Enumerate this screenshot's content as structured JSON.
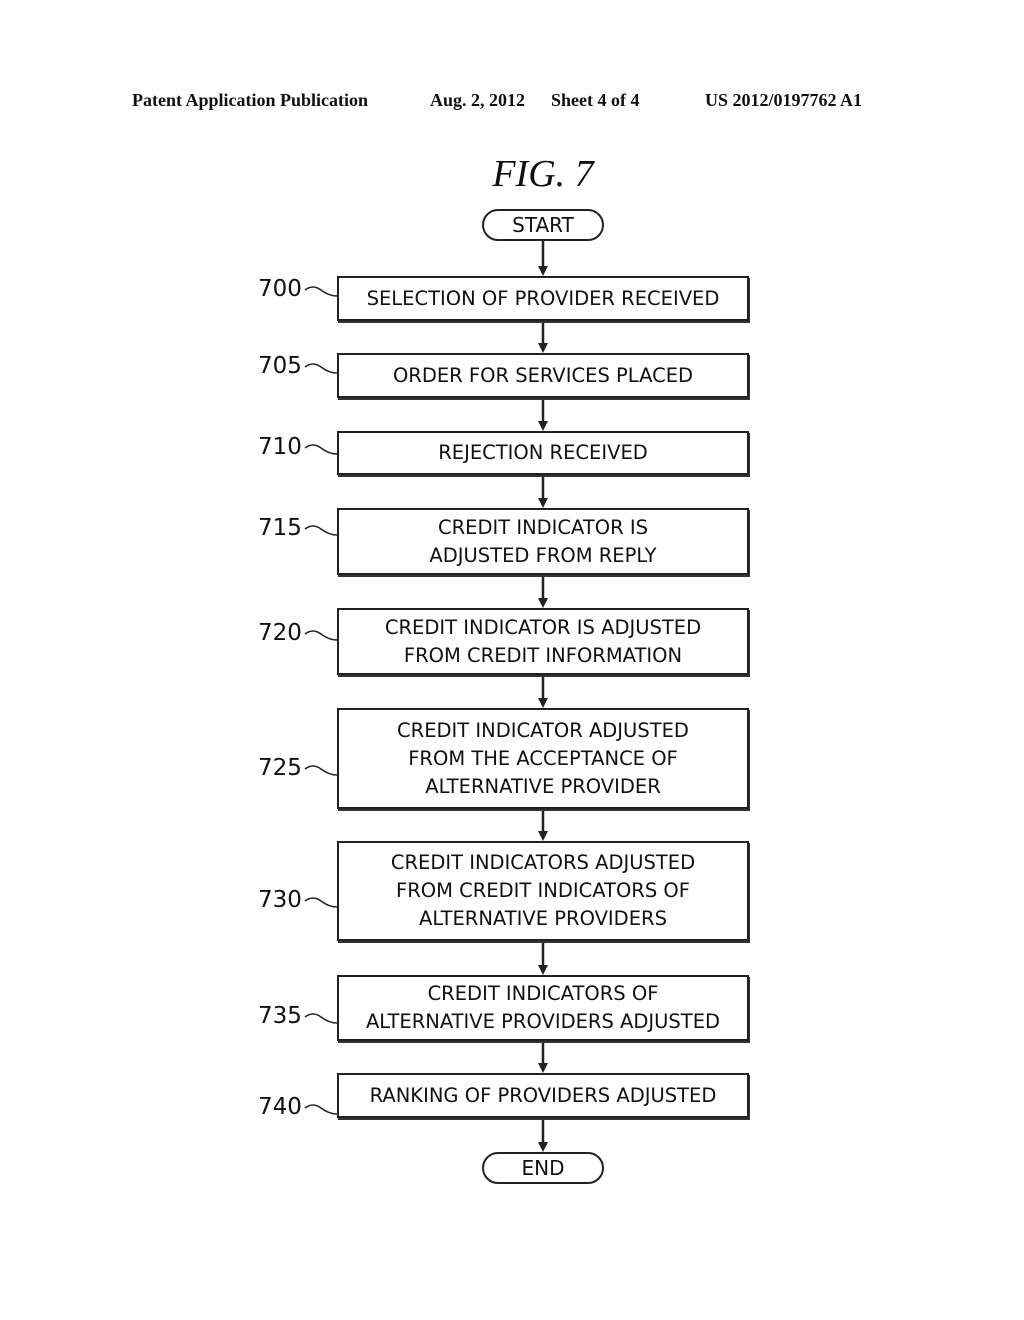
{
  "header": {
    "publication": "Patent Application Publication",
    "date": "Aug. 2, 2012",
    "sheet": "Sheet 4 of 4",
    "number": "US 2012/0197762 A1"
  },
  "figure": {
    "title": "FIG. 7",
    "start": "START",
    "end": "END",
    "steps": [
      {
        "ref": "700",
        "lines": [
          "SELECTION OF PROVIDER RECEIVED"
        ]
      },
      {
        "ref": "705",
        "lines": [
          "ORDER FOR SERVICES PLACED"
        ]
      },
      {
        "ref": "710",
        "lines": [
          "REJECTION RECEIVED"
        ]
      },
      {
        "ref": "715",
        "lines": [
          "CREDIT INDICATOR IS",
          "ADJUSTED FROM REPLY"
        ]
      },
      {
        "ref": "720",
        "lines": [
          "CREDIT INDICATOR IS ADJUSTED",
          "FROM CREDIT INFORMATION"
        ]
      },
      {
        "ref": "725",
        "lines": [
          "CREDIT INDICATOR ADJUSTED",
          "FROM THE ACCEPTANCE OF",
          "ALTERNATIVE PROVIDER"
        ]
      },
      {
        "ref": "730",
        "lines": [
          "CREDIT INDICATORS ADJUSTED",
          "FROM CREDIT INDICATORS OF",
          "ALTERNATIVE PROVIDERS"
        ]
      },
      {
        "ref": "735",
        "lines": [
          "CREDIT INDICATORS OF",
          "ALTERNATIVE PROVIDERS ADJUSTED"
        ]
      },
      {
        "ref": "740",
        "lines": [
          "RANKING OF PROVIDERS ADJUSTED"
        ]
      }
    ]
  }
}
